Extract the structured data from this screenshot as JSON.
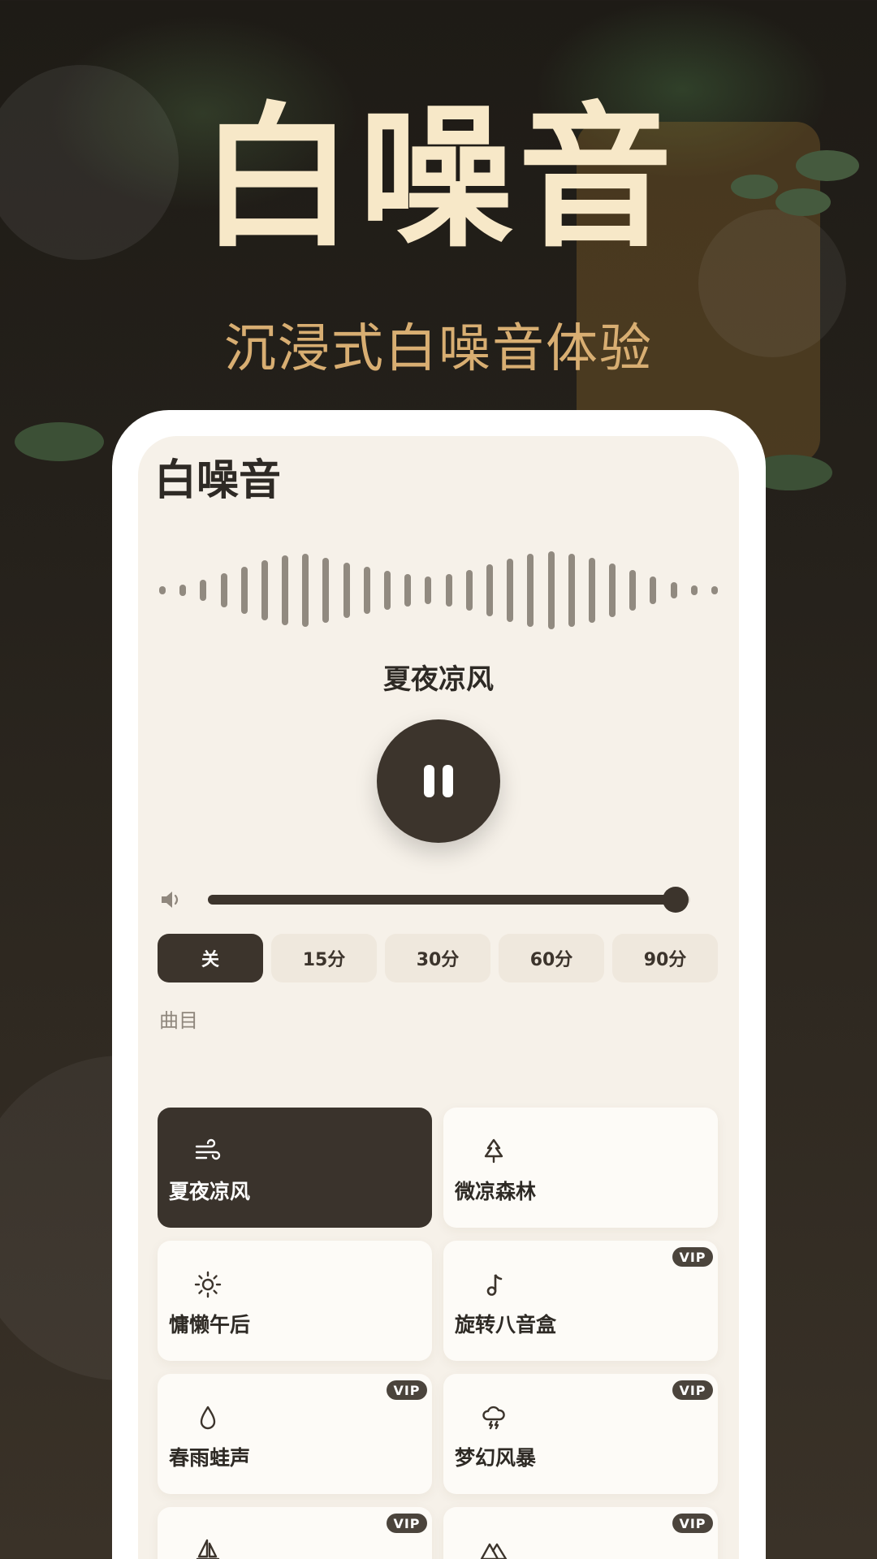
{
  "hero": {
    "title": "白噪音",
    "subtitle": "沉浸式白噪音体验"
  },
  "app": {
    "title": "白噪音",
    "now_playing": "夏夜凉风",
    "play_state_icon": "pause-icon",
    "volume_level": 0.97,
    "section_label": "曲目"
  },
  "timer": {
    "options": [
      "关",
      "15分",
      "30分",
      "60分",
      "90分"
    ],
    "selected": "关"
  },
  "tracks": [
    {
      "label": "夏夜凉风",
      "icon": "wind-icon",
      "vip": false,
      "active": true
    },
    {
      "label": "微凉森林",
      "icon": "pine-tree-icon",
      "vip": false,
      "active": false
    },
    {
      "label": "慵懒午后",
      "icon": "sun-icon",
      "vip": false,
      "active": false
    },
    {
      "label": "旋转八音盒",
      "icon": "music-note-icon",
      "vip": true,
      "active": false
    },
    {
      "label": "春雨蛙声",
      "icon": "water-drop-icon",
      "vip": true,
      "active": false
    },
    {
      "label": "梦幻风暴",
      "icon": "storm-cloud-icon",
      "vip": true,
      "active": false
    },
    {
      "label": "",
      "icon": "sailboat-icon",
      "vip": true,
      "active": false
    },
    {
      "label": "",
      "icon": "mountains-icon",
      "vip": true,
      "active": false
    }
  ],
  "vip_label": "VIP",
  "colors": {
    "accent_dark": "#3c342c",
    "title_cream": "#f7e8c8",
    "subtitle_gold": "#d8ae72",
    "screen_bg": "#f6f1e9"
  }
}
